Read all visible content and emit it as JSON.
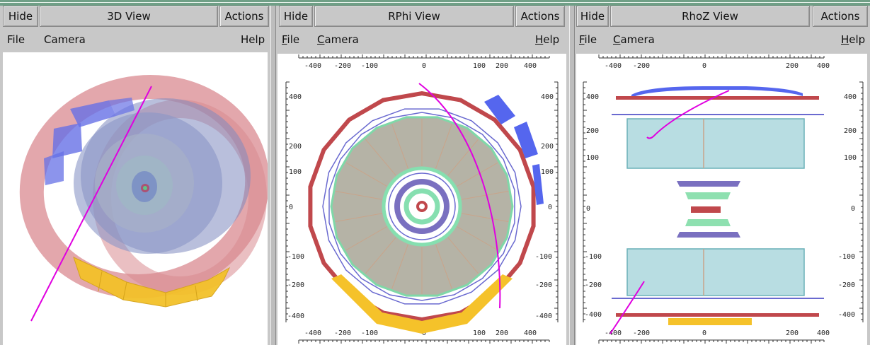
{
  "panels": [
    {
      "id": "3d",
      "hide_label": "Hide",
      "title": "3D View",
      "actions_label": "Actions",
      "menu": {
        "file": "File",
        "camera": "Camera",
        "help": "Help"
      }
    },
    {
      "id": "rphi",
      "hide_label": "Hide",
      "title": "RPhi View",
      "actions_label": "Actions",
      "menu": {
        "file": "File",
        "camera": "Camera",
        "help": "Help"
      },
      "x_ticks": [
        "-400",
        "-200",
        "-100",
        "0",
        "100",
        "200",
        "400"
      ],
      "y_ticks": [
        "400",
        "200",
        "100",
        "0",
        "-100",
        "-200",
        "-400"
      ]
    },
    {
      "id": "rhoz",
      "hide_label": "Hide",
      "title": "RhoZ View",
      "actions_label": "Actions",
      "menu": {
        "file": "File",
        "camera": "Camera",
        "help": "Help"
      },
      "x_ticks_top": [
        "-400",
        "-200",
        "0",
        "200",
        "400"
      ],
      "x_ticks_bottom": [
        "-400",
        "-200",
        "0",
        "200",
        "400"
      ],
      "y_ticks": [
        "400",
        "200",
        "100",
        "0",
        "-100",
        "-200",
        "-400"
      ]
    }
  ],
  "colors": {
    "frame_bg": "#c8c8c8",
    "viewport_bg": "#ffffff",
    "track": "#e000e0",
    "ecal_gold": "#f5c22a",
    "muon_blue": "#5566ee",
    "coil_red": "#c0484c",
    "tracker_green": "#8ee0b0",
    "vertex_purple": "#7a70c0"
  }
}
